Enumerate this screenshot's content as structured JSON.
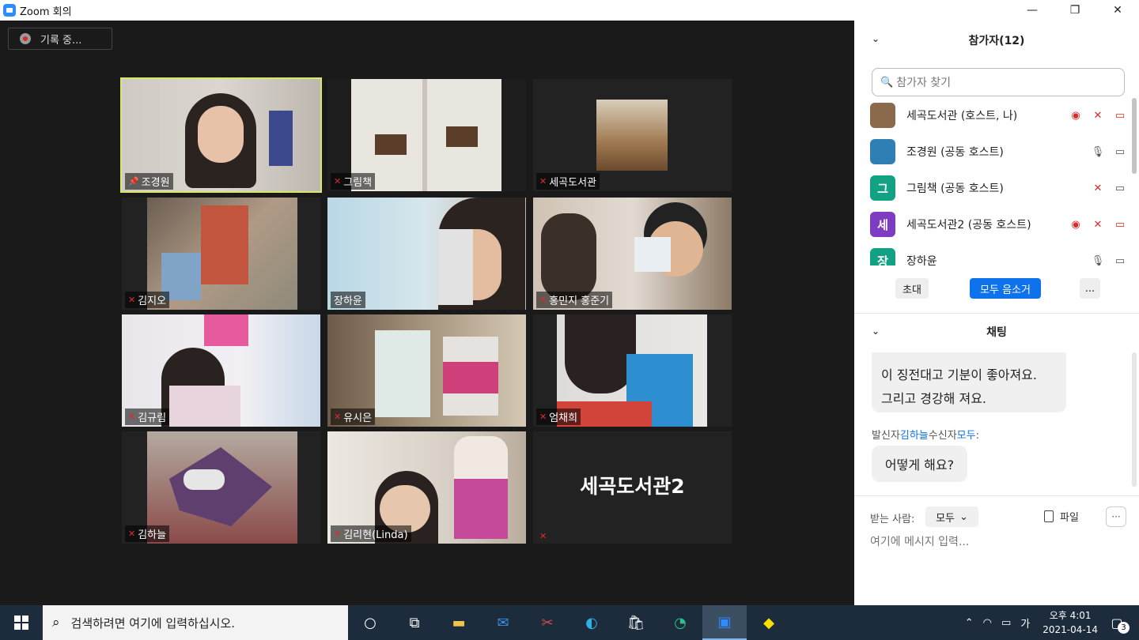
{
  "window": {
    "title": "Zoom 회의",
    "controls": [
      "—",
      "❐",
      "✕"
    ]
  },
  "recording": {
    "label": "기록 중..."
  },
  "tiles": [
    {
      "name": "조경원",
      "pinned": true,
      "muted": false,
      "active": true
    },
    {
      "name": "그림책",
      "muted": true
    },
    {
      "name": "세곡도서관",
      "muted": true
    },
    {
      "name": "김지오",
      "muted": true
    },
    {
      "name": "장하윤",
      "muted": false
    },
    {
      "name": "홍민지 홍준기",
      "muted": true
    },
    {
      "name": "김규림",
      "muted": true
    },
    {
      "name": "유시은",
      "muted": true
    },
    {
      "name": "엄채희",
      "muted": true
    },
    {
      "name": "김하늘",
      "muted": true
    },
    {
      "name": "김리현(Linda)",
      "muted": true
    },
    {
      "name": "",
      "muted": true,
      "placeholder": "세곡도서관2"
    }
  ],
  "participants": {
    "header": "참가자(12)",
    "search_placeholder": "참가자 찾기",
    "list": [
      {
        "name": "세곡도서관 (호스트, 나)",
        "avatar": "",
        "avatar_color": "#8a6a4a",
        "recording": true,
        "mic_muted": true,
        "video_off": true
      },
      {
        "name": "조경원 (공동 호스트)",
        "avatar": "",
        "avatar_color": "#2f7fb5",
        "recording": false,
        "mic_muted": false,
        "video_off": false
      },
      {
        "name": "그림책 (공동 호스트)",
        "avatar": "그",
        "avatar_color": "#13a184",
        "recording": false,
        "mic_muted": true,
        "video_off": false
      },
      {
        "name": "세곡도서관2 (공동 호스트)",
        "avatar": "세",
        "avatar_color": "#7d3cc2",
        "recording": true,
        "mic_muted": true,
        "video_off": true
      },
      {
        "name": "장하윤",
        "avatar": "장",
        "avatar_color": "#13a184",
        "recording": false,
        "mic_muted": false,
        "video_off": false
      }
    ],
    "buttons": {
      "invite": "초대",
      "mute_all": "모두 음소거",
      "more": "..."
    }
  },
  "chat": {
    "header": "채팅",
    "message1_line1": "이 징전대고 기분이 좋아져요.",
    "message1_line2": "그리고 경강해 져요.",
    "sender_prefix": "발신자",
    "sender_name": "김하늘",
    "receiver_prefix": "수신자",
    "receiver_name": "모두",
    "sender_suffix": ":",
    "message2": "어떻게 해요?",
    "to_label": "받는 사람:",
    "to_value": "모두",
    "file_label": "파일",
    "more": "···",
    "input_placeholder": "여기에 메시지 입력..."
  },
  "taskbar": {
    "search_text": "검색하려면 여기에 입력하십시오.",
    "ime": "가",
    "time": "오후 4:01",
    "date": "2021-04-14",
    "notification_count": "3"
  },
  "colors": {
    "accent": "#0e72ed",
    "muted_red": "#e02828",
    "active_speaker_border": "#d8e86b"
  }
}
